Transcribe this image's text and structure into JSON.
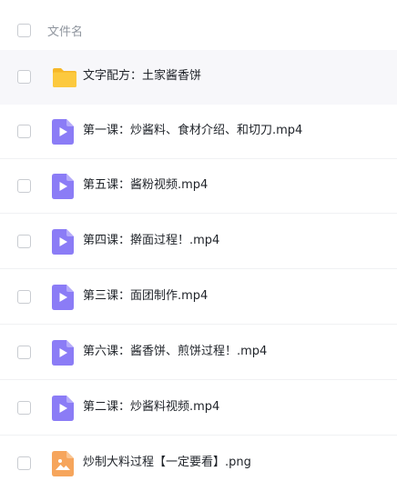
{
  "header": {
    "column_label": "文件名"
  },
  "files": [
    {
      "name": "文字配方：土家酱香饼",
      "type": "folder",
      "icon": "folder-icon"
    },
    {
      "name": "第一课：炒酱料、食材介绍、和切刀.mp4",
      "type": "video",
      "icon": "video-file-icon"
    },
    {
      "name": "第五课：酱粉视频.mp4",
      "type": "video",
      "icon": "video-file-icon"
    },
    {
      "name": "第四课：擀面过程！.mp4",
      "type": "video",
      "icon": "video-file-icon"
    },
    {
      "name": "第三课：面团制作.mp4",
      "type": "video",
      "icon": "video-file-icon"
    },
    {
      "name": "第六课：酱香饼、煎饼过程！.mp4",
      "type": "video",
      "icon": "video-file-icon"
    },
    {
      "name": "第二课：炒酱料视频.mp4",
      "type": "video",
      "icon": "video-file-icon"
    },
    {
      "name": "炒制大料过程【一定要看】.png",
      "type": "image",
      "icon": "image-file-icon"
    }
  ],
  "colors": {
    "folder": "#fcc93e",
    "video": "#8b7cf6",
    "image": "#f6a55c",
    "hover_row": "#f7f7fa"
  }
}
